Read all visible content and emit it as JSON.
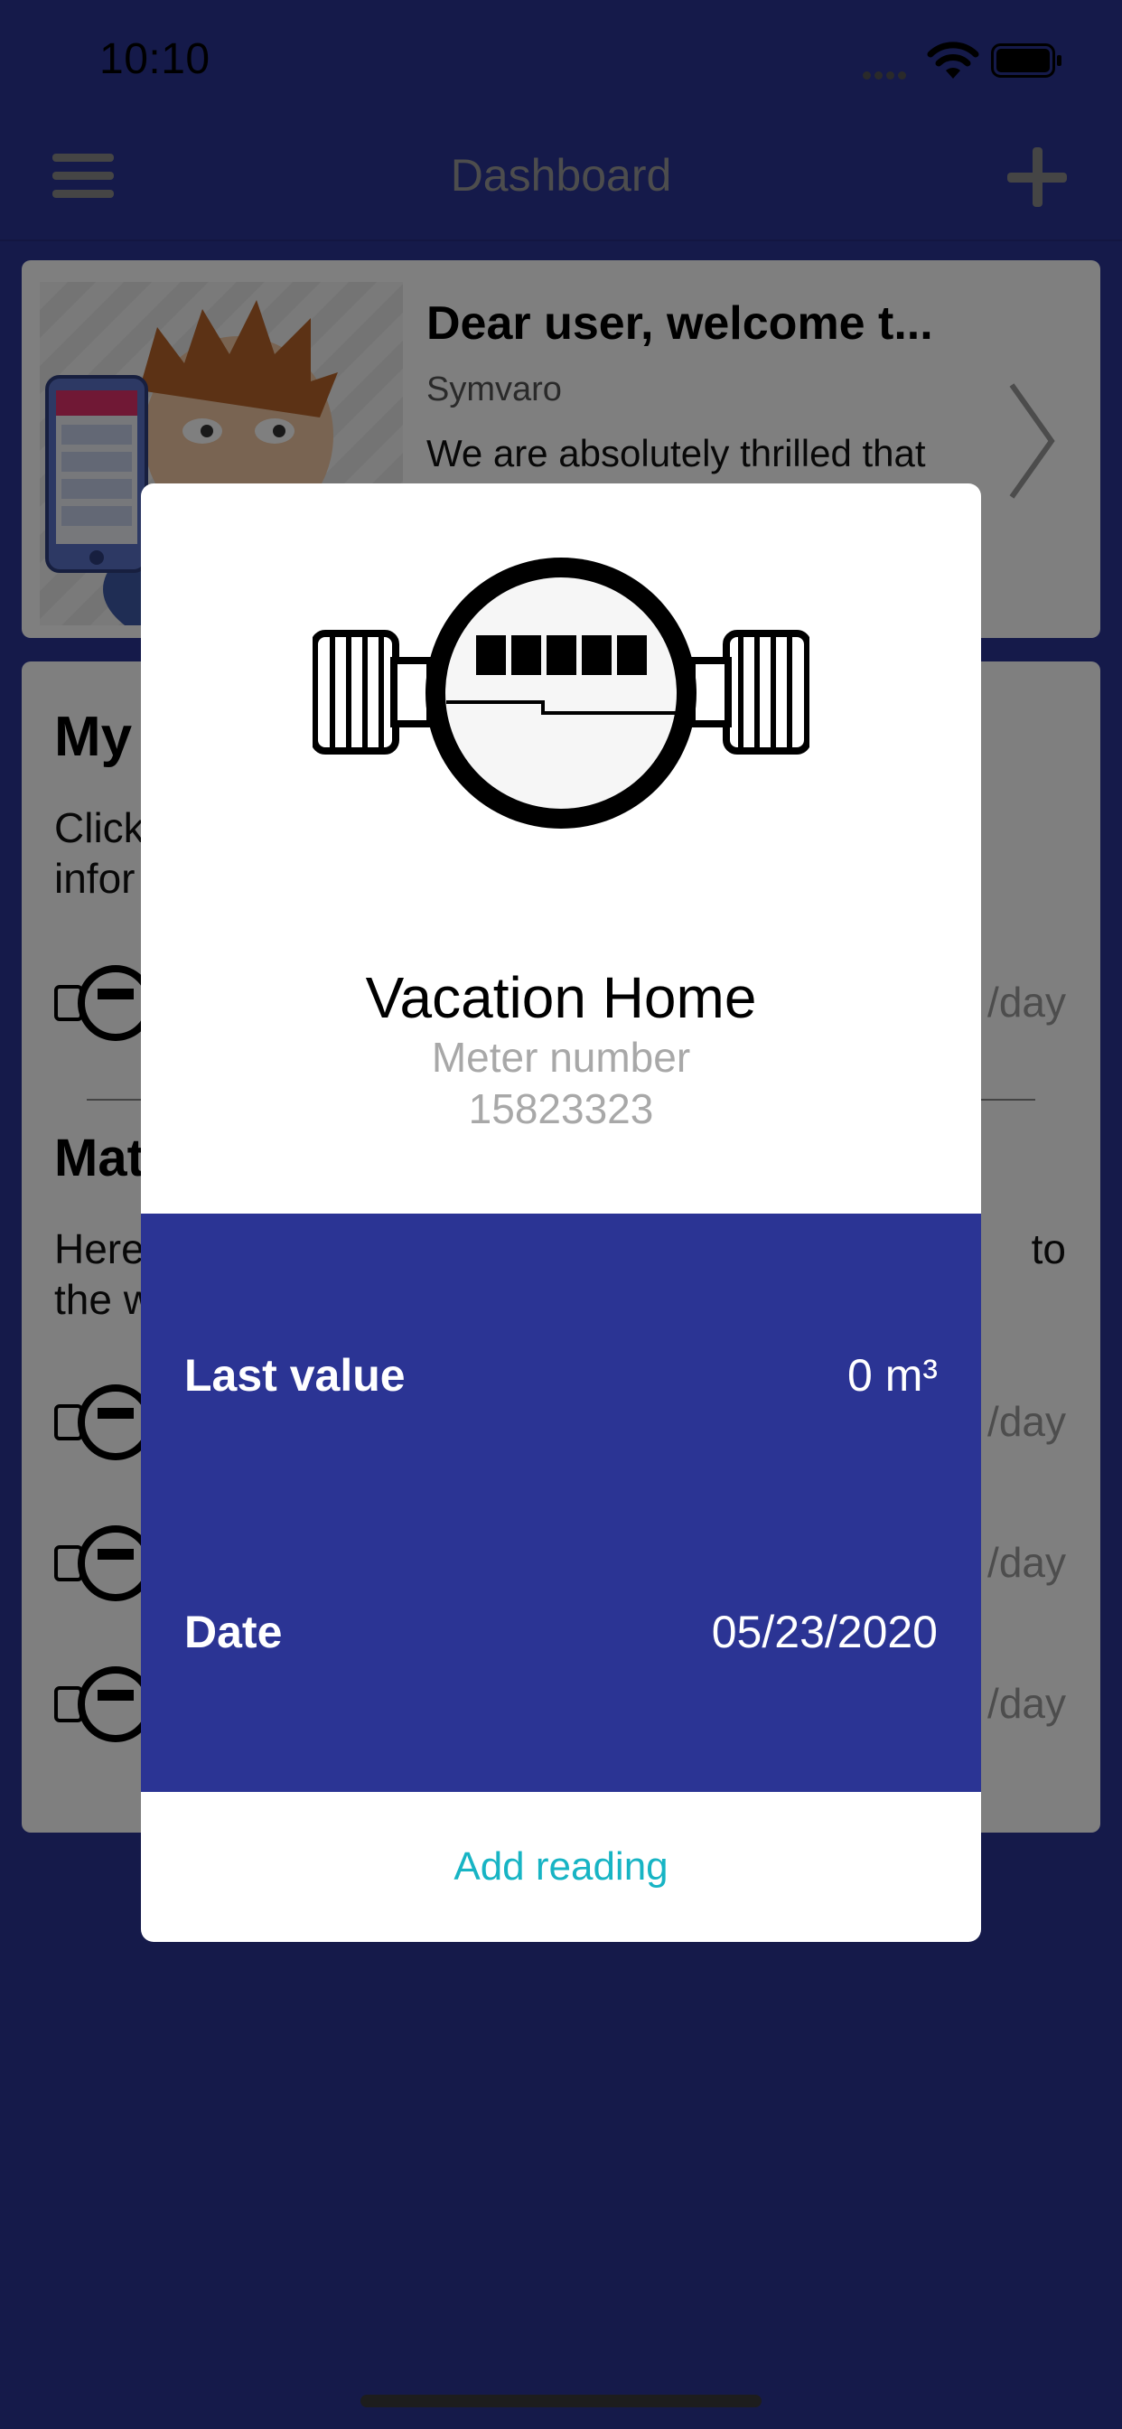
{
  "status_bar": {
    "time": "10:10"
  },
  "nav": {
    "title": "Dashboard",
    "menu_icon": "hamburger-menu-icon",
    "add_icon": "plus-icon"
  },
  "welcome_card": {
    "title": "Dear user, welcome t...",
    "author": "Symvaro",
    "text": "We are absolutely thrilled that"
  },
  "meters_card": {
    "title_partial": "My",
    "desc_partial_1": "Click",
    "desc_partial_2": "infor",
    "rate_partial": "/day",
    "section_title_partial": "Mat",
    "section_desc_partial_1": "Here",
    "section_desc_partial_1_end": "to",
    "section_desc_partial_2": "the w",
    "rows_rate": [
      "/day",
      "/day",
      "/day"
    ]
  },
  "modal": {
    "title": "Vacation Home",
    "meter_number_label": "Meter number",
    "meter_number_value": "15823323",
    "last_value_label": "Last value",
    "last_value": "0 m³",
    "date_label": "Date",
    "date_value": "05/23/2020",
    "add_reading_label": "Add reading"
  },
  "colors": {
    "brand_blue": "#2b3494",
    "accent_teal": "#17b4c4",
    "dark_bg": "#141848"
  }
}
